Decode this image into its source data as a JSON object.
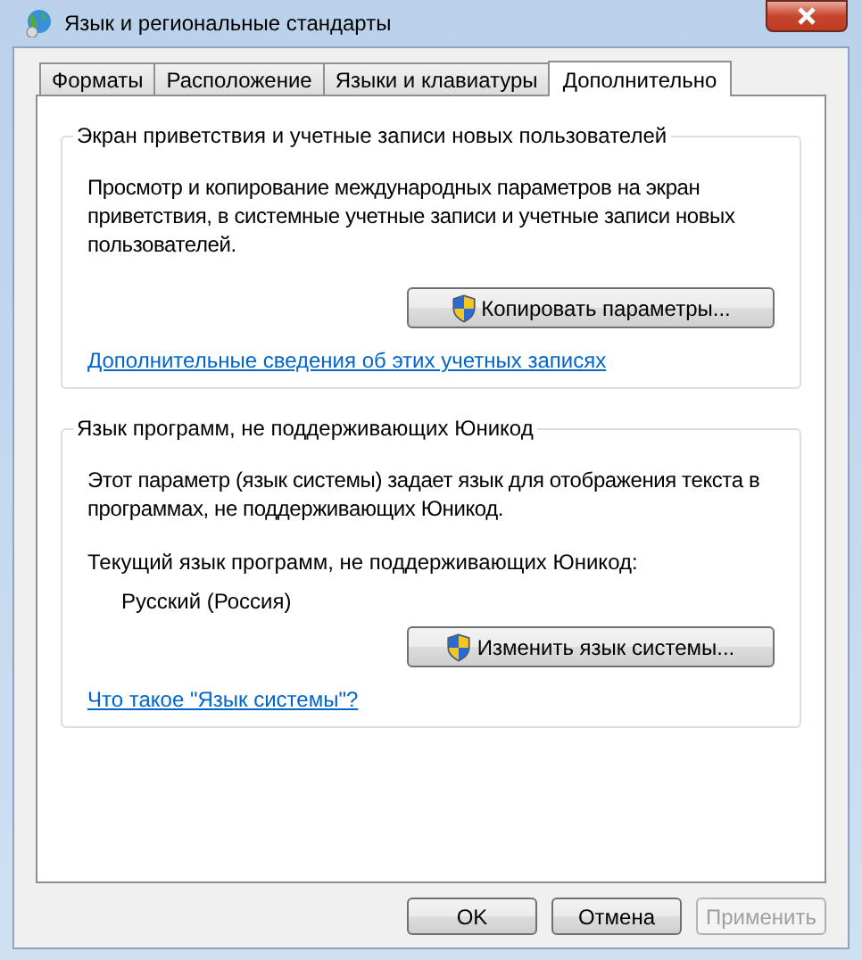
{
  "window": {
    "title": "Язык и региональные стандарты"
  },
  "tabs": [
    {
      "label": "Форматы",
      "selected": false
    },
    {
      "label": "Расположение",
      "selected": false
    },
    {
      "label": "Языки и клавиатуры",
      "selected": false
    },
    {
      "label": "Дополнительно",
      "selected": true
    }
  ],
  "groups": [
    {
      "title": "Экран приветствия и учетные записи новых пользователей",
      "description": "Просмотр и копирование международных параметров на экран приветствия, в системные учетные записи и учетные записи новых пользователей.",
      "button": {
        "label": "Копировать параметры..."
      },
      "link": "Дополнительные сведения об этих учетных записях"
    },
    {
      "title": "Язык программ, не поддерживающих Юникод",
      "description": "Этот параметр (язык системы) задает язык для отображения текста в программах, не поддерживающих Юникод.",
      "current_label": "Текущий язык программ, не поддерживающих Юникод:",
      "current_value": "Русский (Россия)",
      "button": {
        "label": "Изменить язык системы..."
      },
      "link": "Что такое \"Язык системы\"?"
    }
  ],
  "buttons": [
    {
      "label": "OK",
      "disabled": false
    },
    {
      "label": "Отмена",
      "disabled": false
    },
    {
      "label": "Применить",
      "disabled": true
    }
  ]
}
